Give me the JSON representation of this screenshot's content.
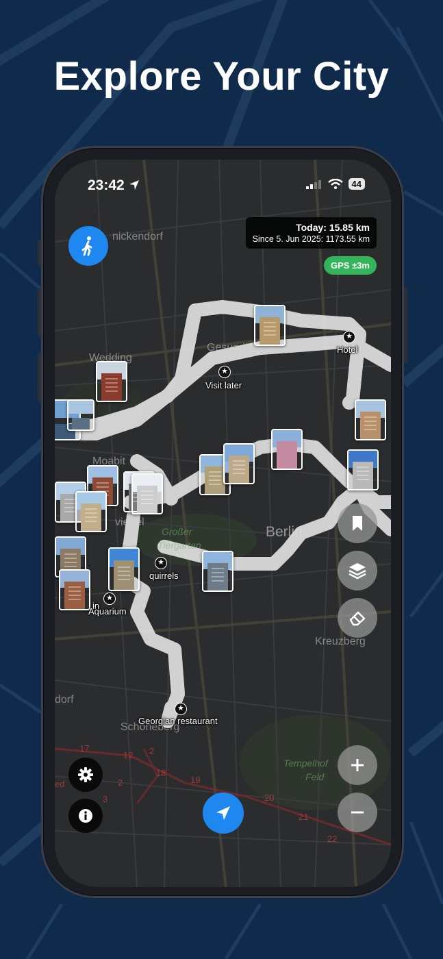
{
  "headline": "Explore Your City",
  "status_bar": {
    "time": "23:42",
    "battery": "44"
  },
  "stats": {
    "today": "Today: 15.85 km",
    "since": "Since 5. Jun 2025: 1173.55 km",
    "gps": "GPS ±3m"
  },
  "map": {
    "pins": [
      {
        "label": "Hotel"
      },
      {
        "label": "Visit later"
      },
      {
        "label": "quirrels"
      },
      {
        "label": "Aquarium"
      },
      {
        "label": "Georgian restaurant"
      }
    ],
    "place_names": {
      "reinickendorf": "nickendorf",
      "wedding": "Wedding",
      "gesundbrunnen": "Gesundbrunnen",
      "moabit": "Moabit",
      "hansaviertel": "viertel",
      "berlin": "Berlin",
      "tiergarten_1": "Großer",
      "tiergarten_2": "Tiergarten",
      "kreuzberg": "Kreuzberg",
      "wilmersdorf": "dorf",
      "schoeneberg": "Schöneberg",
      "tempelhof_1": "Tempelhof",
      "tempelhof_2": "Feld",
      "in": "in"
    },
    "route_numbers": [
      "17",
      "12",
      "2",
      "18",
      "2",
      "19",
      "20",
      "3",
      "21",
      "22",
      "ed"
    ]
  },
  "colors": {
    "background": "#0f2a4a",
    "primary_blue": "#1e88f0",
    "gps_green": "#34b45a",
    "control_gray": "#969696"
  },
  "icons": {
    "walk": "walk-icon",
    "bookmark": "bookmark-icon",
    "layers": "layers-icon",
    "eraser": "eraser-icon",
    "zoom_in": "plus-icon",
    "zoom_out": "minus-icon",
    "settings": "gear-icon",
    "info": "info-icon",
    "locate": "location-arrow-icon"
  }
}
